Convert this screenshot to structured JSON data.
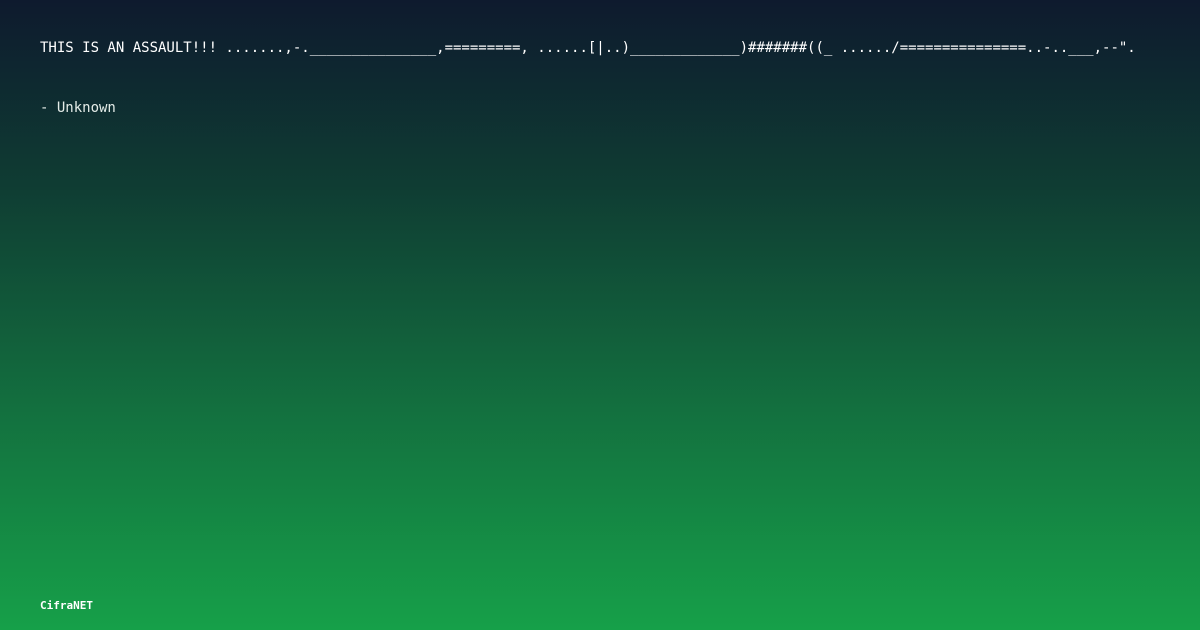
{
  "quote": {
    "text": "THIS IS AN ASSAULT!!! .......,-._______________,=========, ......[|..)_____________)#######((_ ....../===============..-..___,--\".",
    "author": "- Unknown"
  },
  "brand": {
    "name": "CifraNET"
  },
  "colors": {
    "background_top": "#0e1a2e",
    "background_bottom": "#16a049",
    "text": "#ffffff"
  }
}
